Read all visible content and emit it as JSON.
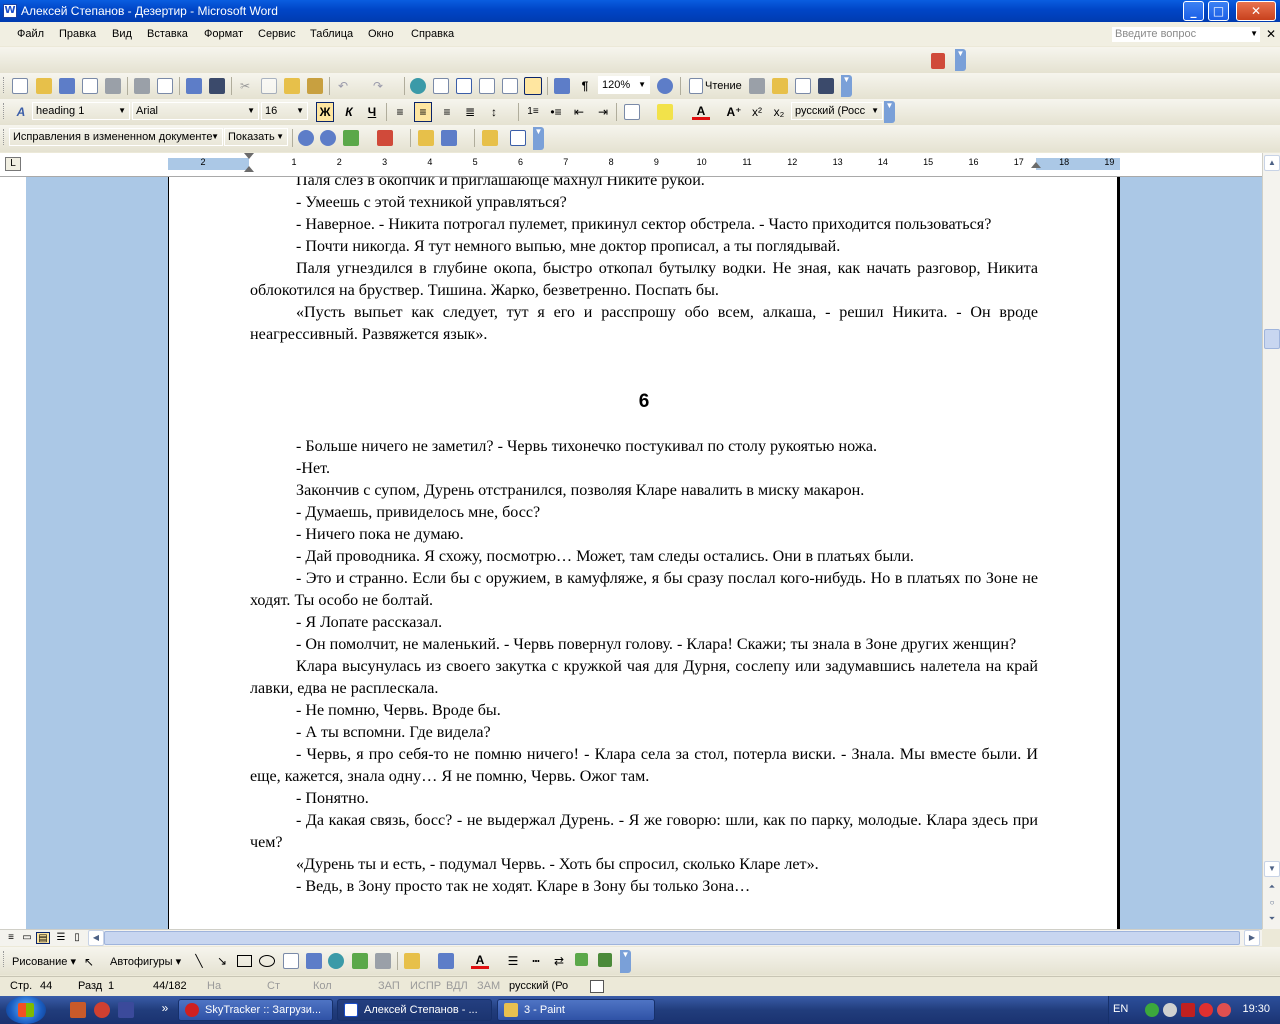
{
  "window": {
    "title": "Алексей Степанов - Дезертир - Microsoft Word"
  },
  "menu": {
    "items": [
      "Файл",
      "Правка",
      "Вид",
      "Вставка",
      "Формат",
      "Сервис",
      "Таблица",
      "Окно",
      "Справка"
    ],
    "ask_placeholder": "Введите вопрос"
  },
  "standard_toolbar": {
    "zoom": "120%",
    "reading_label": "Чтение"
  },
  "formatting_toolbar": {
    "style": "heading 1",
    "font": "Arial",
    "size": "16",
    "bold_label": "Ж",
    "italic_label": "К",
    "underline_label": "Ч",
    "language": "русский (Росс"
  },
  "review_toolbar": {
    "display_mode": "Исправления в измененном документе",
    "show_label": "Показать"
  },
  "ruler": {
    "numbers_left": [
      "2",
      "1"
    ],
    "numbers_right": [
      "1",
      "2",
      "3",
      "4",
      "5",
      "6",
      "7",
      "8",
      "9",
      "10",
      "11",
      "12",
      "13",
      "14",
      "15",
      "16",
      "17",
      "18",
      "19"
    ]
  },
  "document": {
    "paragraphs_before": [
      "Паля слез в окопчик и приглашающе махнул Никите рукой.",
      "- Умеешь с этой техникой управляться?",
      "- Наверное. - Никита потрогал пулемет, прикинул сектор обстрела. - Часто приходится пользоваться?",
      "- Почти никогда. Я тут немного выпью, мне доктор прописал, а ты поглядывай.",
      "Паля угнездился в глубине окопа, быстро откопал бутылку водки. Не зная, как начать разговор, Никита облокотился на бруствер. Тишина. Жарко, безветренно. Поспать бы.",
      "«Пусть выпьет как следует, тут я его и расспрошу обо всем, алкаша, - решил Никита. - Он вроде неагрессивный. Развяжется язык»."
    ],
    "chapter_heading": "6",
    "paragraphs_after": [
      "- Больше ничего не заметил? - Червь тихонечко постукивал по столу рукоятью ножа.",
      "-Нет.",
      "Закончив с супом, Дурень отстранился, позволяя Кларе навалить в миску макарон.",
      "- Думаешь, привиделось мне, босс?",
      "- Ничего пока не думаю.",
      "- Дай проводника. Я схожу, посмотрю… Может, там следы остались. Они в платьях были.",
      "- Это и странно. Если бы с оружием, в камуфляже, я бы сразу послал кого-нибудь. Но в платьях по Зоне не ходят. Ты особо не болтай.",
      "- Я Лопате рассказал.",
      "- Он помолчит, не маленький. - Червь повернул голову. - Клара! Скажи; ты знала в Зоне других женщин?",
      "Клара высунулась из своего закутка с кружкой чая для Дурня, сослепу или задумавшись налетела на край лавки, едва не расплескала.",
      "- Не помню, Червь. Вроде бы.",
      "- А ты вспомни. Где видела?",
      "- Червь, я про себя-то не помню ничего! - Клара села за стол, потерла виски. - Знала. Мы вместе были. И еще, кажется, знала одну… Я не помню, Червь. Ожог там.",
      "- Понятно.",
      "- Да какая связь, босс? - не выдержал Дурень. - Я же говорю: шли, как по парку, молодые. Клара здесь при чем?",
      "«Дурень ты и есть, - подумал Червь. - Хоть бы спросил, сколько Кларе лет».",
      "- Ведь, в Зону просто так не ходят. Кларе в Зону бы только Зона…"
    ]
  },
  "drawing_toolbar": {
    "draw_label": "Рисование",
    "autoshapes_label": "Автофигуры"
  },
  "status_bar": {
    "page": "Стр.",
    "page_num": "44",
    "section": "Разд",
    "section_num": "1",
    "pages": "44/182",
    "at": "На",
    "line": "Ст",
    "col": "Кол",
    "rec": "ЗАП",
    "trk": "ИСПР",
    "ext": "ВДЛ",
    "ovr": "ЗАМ",
    "language": "русский (Ро"
  },
  "taskbar": {
    "tasks": [
      "SkyTracker :: Загрузи...",
      "Алексей Степанов - ...",
      "3 - Paint"
    ],
    "lang": "EN",
    "time": "19:30"
  },
  "colors": {
    "titlebar": "#0045c6",
    "doc_background": "#abc8e6",
    "taskbar": "#213d7c"
  }
}
